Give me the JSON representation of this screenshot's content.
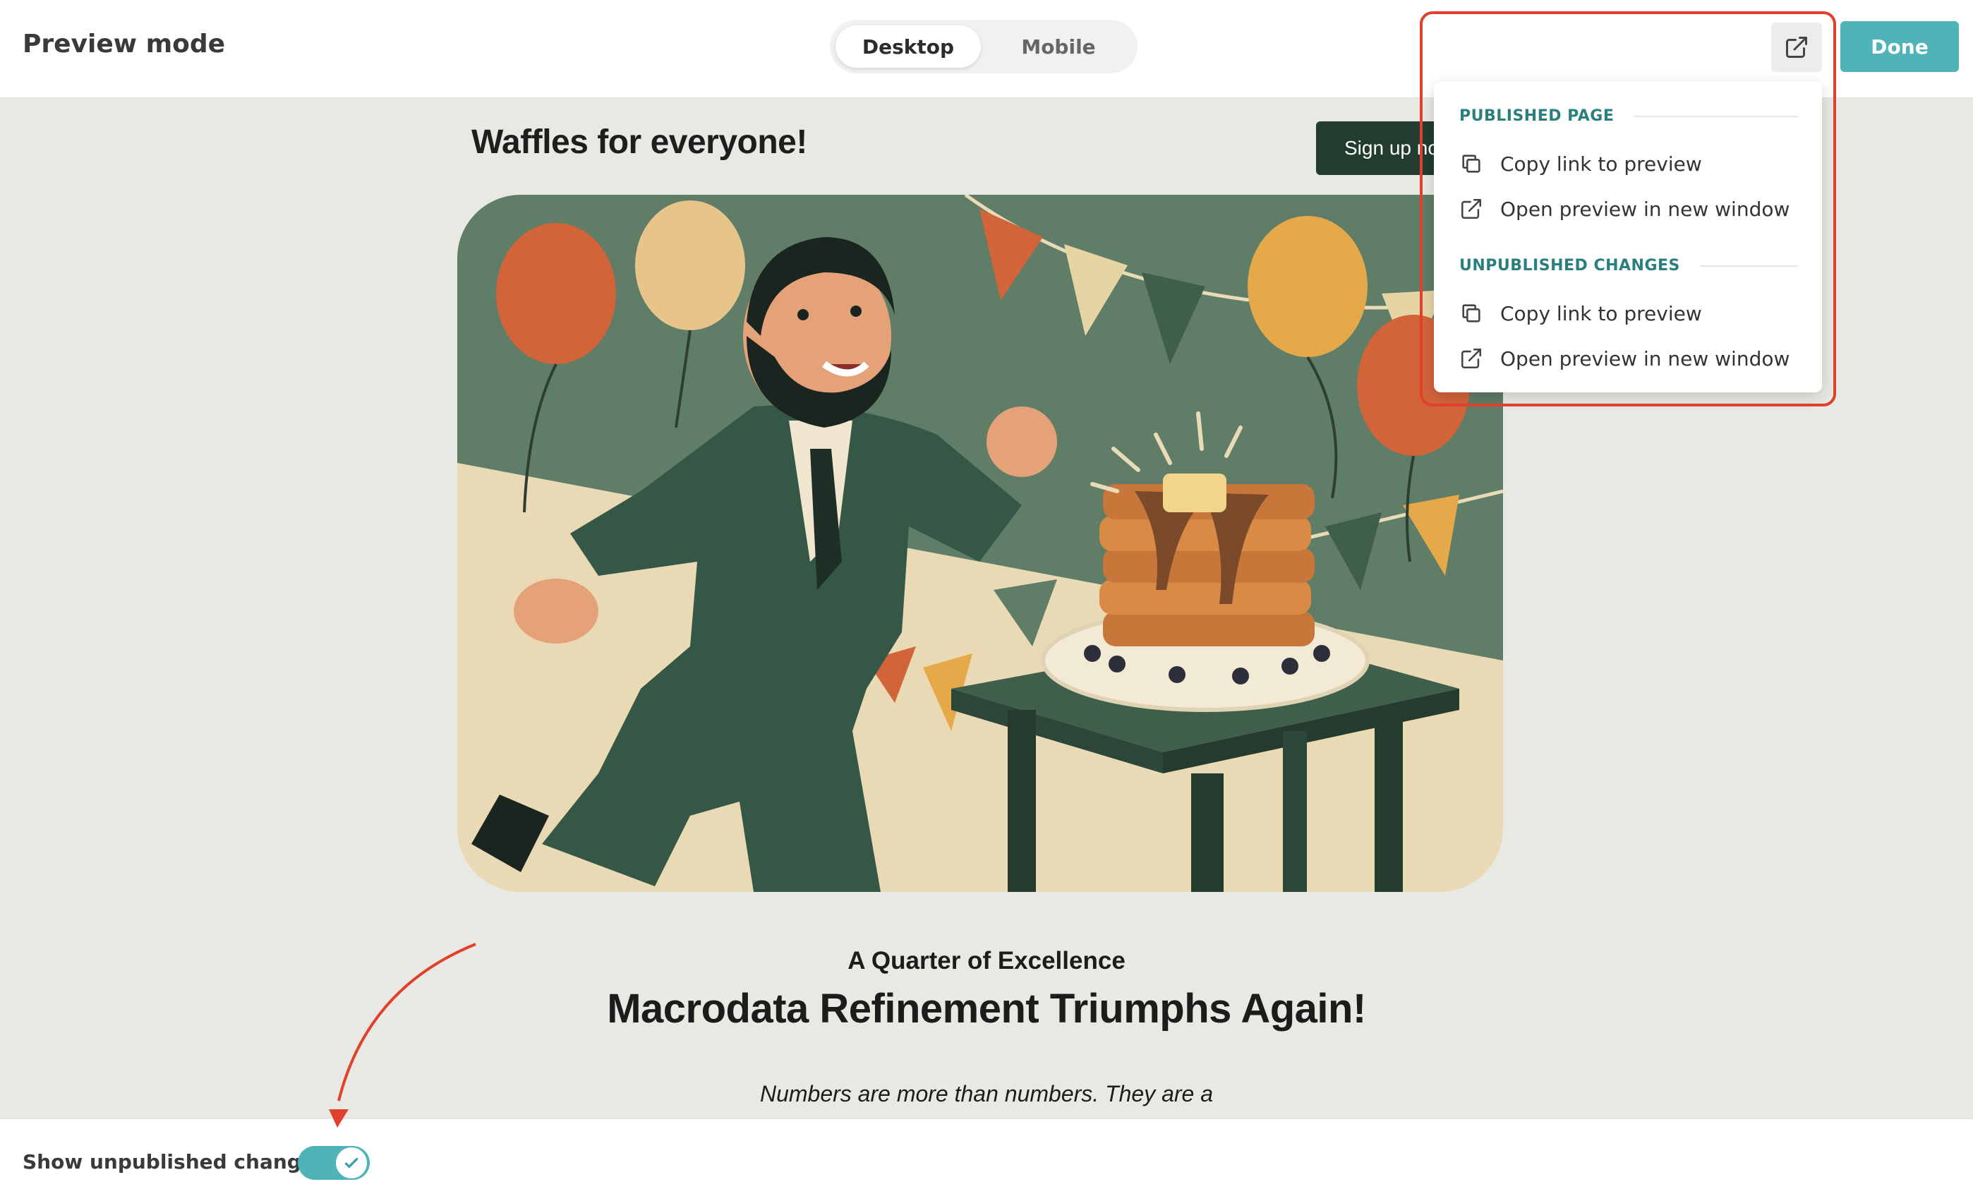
{
  "header": {
    "title": "Preview mode",
    "device_tabs": [
      {
        "label": "Desktop",
        "selected": true
      },
      {
        "label": "Mobile",
        "selected": false
      }
    ],
    "open_external_icon": "external-link-icon",
    "done_label": "Done"
  },
  "preview": {
    "site_title": "Waffles for everyone!",
    "signup_label": "Sign up now",
    "hero_image": "illustration-man-running-to-waffles",
    "kicker": "A Quarter of Excellence",
    "headline": "Macrodata Refinement Triumphs Again!",
    "body_excerpt": "Numbers are more than numbers. They are a"
  },
  "menu": {
    "sections": [
      {
        "title": "PUBLISHED PAGE",
        "items": [
          {
            "label": "Copy link to preview",
            "icon": "copy-icon"
          },
          {
            "label": "Open preview in new window",
            "icon": "external-link-icon"
          }
        ]
      },
      {
        "title": "UNPUBLISHED CHANGES",
        "items": [
          {
            "label": "Copy link to preview",
            "icon": "copy-icon"
          },
          {
            "label": "Open preview in new window",
            "icon": "external-link-icon"
          }
        ]
      }
    ]
  },
  "footer": {
    "toggle_label": "Show unpublished changes",
    "toggle_on": true
  },
  "colors": {
    "accent": "#4fb4b7",
    "section_heading": "#2a7f7e",
    "annotation": "#e0402c",
    "signup_bg": "#223c30",
    "canvas_bg": "#e9e9e4"
  }
}
